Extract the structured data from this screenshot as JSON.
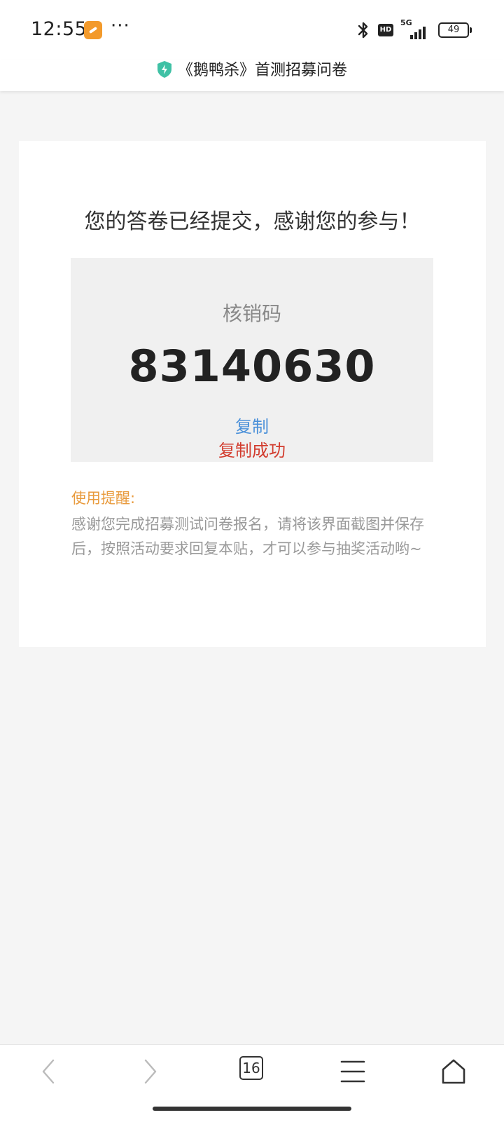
{
  "status_bar": {
    "time": "12:55",
    "more": "···",
    "network": "5G",
    "hd": "HD",
    "battery": "49"
  },
  "title_bar": {
    "title": "《鹅鸭杀》首测招募问卷"
  },
  "card": {
    "headline": "您的答卷已经提交，感谢您的参与！",
    "code_label": "核销码",
    "code_value": "83140630",
    "copy_label": "复制",
    "copy_success": "复制成功",
    "tip_label": "使用提醒:",
    "tip_text": "感谢您完成招募测试问卷报名，请将该界面截图并保存后，按照活动要求回复本贴，才可以参与抽奖活动哟~"
  },
  "bottom_nav": {
    "tab_count": "16"
  },
  "colors": {
    "copy_link": "#4a90d9",
    "copy_success": "#d23c2e",
    "tip_label": "#e89a3c",
    "shield": "#3fc1a5"
  }
}
